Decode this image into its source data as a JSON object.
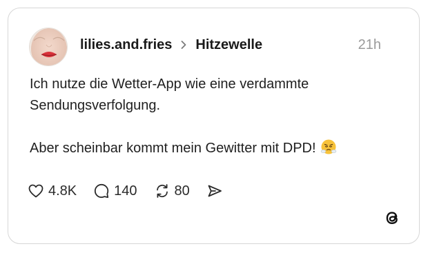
{
  "post": {
    "username": "lilies.and.fries",
    "topic": "Hitzewelle",
    "timestamp": "21h",
    "text_line_1": "Ich nutze die Wetter-App wie eine verdammte",
    "text_line_2": "Sendungsverfolgung.",
    "text_line_3": "Aber scheinbar kommt mein Gewitter mit DPD!",
    "emoji": "face-with-steam-from-nose"
  },
  "actions": {
    "likes": "4.8K",
    "replies": "140",
    "reposts": "80"
  },
  "icons": {
    "like": "heart-icon",
    "reply": "speech-bubble-icon",
    "repost": "repost-icon",
    "share": "send-icon",
    "brand": "threads-logo-icon"
  },
  "colors": {
    "text": "#1f1f1f",
    "muted": "#9a9a9a",
    "border": "#d6d6d6"
  }
}
